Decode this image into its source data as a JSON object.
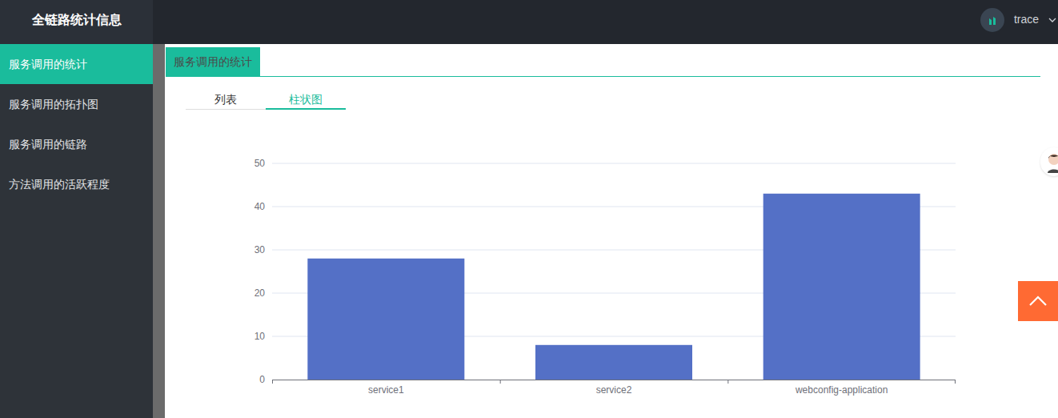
{
  "header": {
    "title": "全链路统计信息",
    "user": "trace"
  },
  "sidebar": {
    "items": [
      {
        "label": "服务调用的统计",
        "selected": true
      },
      {
        "label": "服务调用的拓扑图",
        "selected": false
      },
      {
        "label": "服务调用的链路",
        "selected": false
      },
      {
        "label": "方法调用的活跃程度",
        "selected": false
      }
    ]
  },
  "panel": {
    "title": "服务调用的统计"
  },
  "tabs": [
    {
      "label": "列表",
      "selected": false
    },
    {
      "label": "柱状图",
      "selected": true
    }
  ],
  "chart": {
    "y_ticks": [
      "0",
      "10",
      "20",
      "30",
      "40",
      "50"
    ],
    "categories": [
      "service1",
      "service2",
      "webconfig-application"
    ],
    "series": [
      {
        "values": [
          28,
          8,
          43
        ]
      }
    ]
  }
}
